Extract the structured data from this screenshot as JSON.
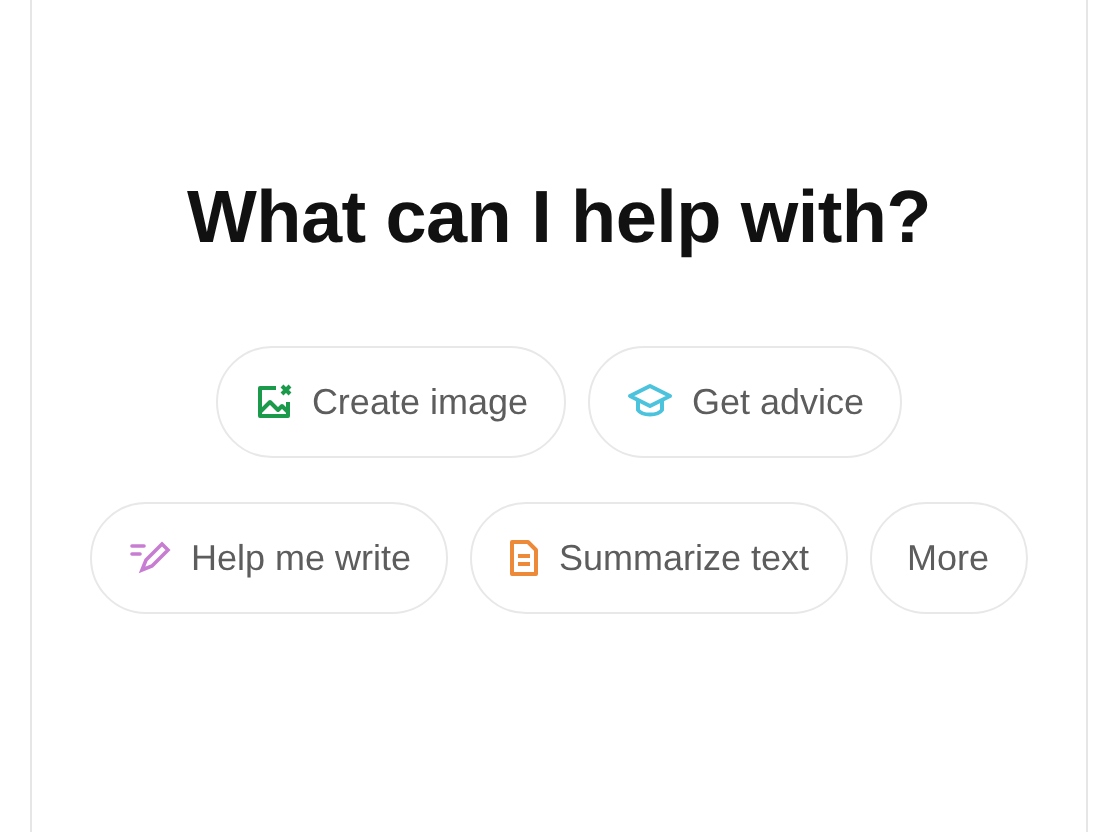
{
  "heading": "What can I help with?",
  "suggestions": [
    [
      {
        "label": "Create image",
        "kind": "image"
      },
      {
        "label": "Get advice",
        "kind": "advice"
      }
    ],
    [
      {
        "label": "Help me write",
        "kind": "write"
      },
      {
        "label": "Summarize text",
        "kind": "summarize"
      },
      {
        "label": "More",
        "kind": "plain"
      }
    ]
  ]
}
